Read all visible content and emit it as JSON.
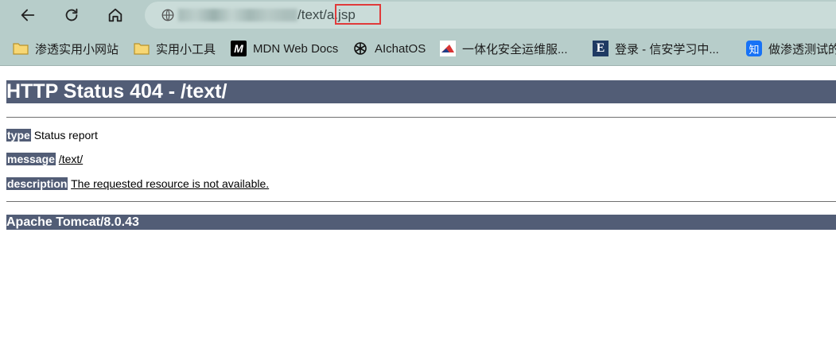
{
  "browser": {
    "url_path": "/text/",
    "url_file": "a.jsp",
    "bookmarks": [
      {
        "label": "渗透实用小网站",
        "icon": "folder-icon"
      },
      {
        "label": "实用小工具",
        "icon": "folder-icon"
      },
      {
        "label": "MDN Web Docs",
        "icon": "mdn-icon"
      },
      {
        "label": "AIchatOS",
        "icon": "openai-icon"
      },
      {
        "label": "一体化安全运维服...",
        "icon": "site-logo-icon"
      },
      {
        "label": "登录 - 信安学习中...",
        "icon": "e-logo-icon"
      },
      {
        "label": "做渗透测试的",
        "icon": "zhihu-icon"
      }
    ],
    "zhihu_glyph": "知",
    "e_glyph": "E",
    "mdn_glyph": "M"
  },
  "page": {
    "title": "HTTP Status 404 - /text/",
    "type_label": "type",
    "type_value": "Status report",
    "message_label": "message",
    "message_value": "/text/",
    "description_label": "description",
    "description_value": "The requested resource is not available.",
    "footer": "Apache Tomcat/8.0.43"
  },
  "colors": {
    "header_bg": "#525d76",
    "chrome_bg": "#b7cdca",
    "highlight_border": "#e03a3a"
  }
}
